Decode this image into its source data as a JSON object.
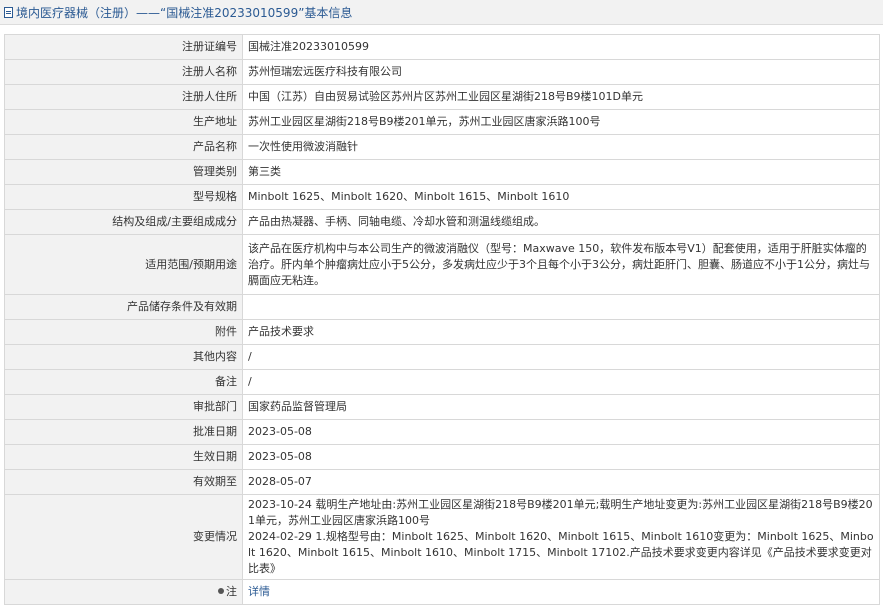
{
  "header": {
    "title": "境内医疗器械（注册）——“国械注准20233010599”基本信息"
  },
  "rows": [
    {
      "label": "注册证编号",
      "value": "国械注准20233010599"
    },
    {
      "label": "注册人名称",
      "value": "苏州恒瑞宏远医疗科技有限公司"
    },
    {
      "label": "注册人住所",
      "value": "中国（江苏）自由贸易试验区苏州片区苏州工业园区星湖街218号B9楼101D单元"
    },
    {
      "label": "生产地址",
      "value": "苏州工业园区星湖街218号B9楼201单元，苏州工业园区唐家浜路100号"
    },
    {
      "label": "产品名称",
      "value": "一次性使用微波消融针"
    },
    {
      "label": "管理类别",
      "value": "第三类"
    },
    {
      "label": "型号规格",
      "value": "Minbolt 1625、Minbolt 1620、Minbolt 1615、Minbolt 1610"
    },
    {
      "label": "结构及组成/主要组成成分",
      "value": "产品由热凝器、手柄、同轴电缆、冷却水管和测温线缆组成。"
    },
    {
      "label": "适用范围/预期用途",
      "value": "该产品在医疗机构中与本公司生产的微波消融仪（型号：Maxwave 150，软件发布版本号V1）配套使用，适用于肝脏实体瘤的治疗。肝内单个肿瘤病灶应小于5公分，多发病灶应少于3个且每个小于3公分，病灶距肝门、胆囊、肠道应不小于1公分，病灶与膈面应无粘连。"
    },
    {
      "label": "产品储存条件及有效期",
      "value": ""
    },
    {
      "label": "附件",
      "value": "产品技术要求"
    },
    {
      "label": "其他内容",
      "value": "/"
    },
    {
      "label": "备注",
      "value": "/"
    },
    {
      "label": "审批部门",
      "value": "国家药品监督管理局"
    },
    {
      "label": "批准日期",
      "value": "2023-05-08"
    },
    {
      "label": "生效日期",
      "value": "2023-05-08"
    },
    {
      "label": "有效期至",
      "value": "2028-05-07"
    }
  ],
  "change": {
    "label": "变更情况",
    "line1": "2023-10-24 载明生产地址由:苏州工业园区星湖街218号B9楼201单元;载明生产地址变更为:苏州工业园区星湖街218号B9楼201单元，苏州工业园区唐家浜路100号",
    "line2": "2024-02-29 1.规格型号由：Minbolt 1625、Minbolt 1620、Minbolt 1615、Minbolt 1610变更为：Minbolt 1625、Minbolt 1620、Minbolt 1615、Minbolt 1610、Minbolt 1715、Minbolt 17102.产品技术要求变更内容详见《产品技术要求变更对比表》"
  },
  "note": {
    "icon": "bulb-icon",
    "label": "注",
    "link": "详情"
  }
}
